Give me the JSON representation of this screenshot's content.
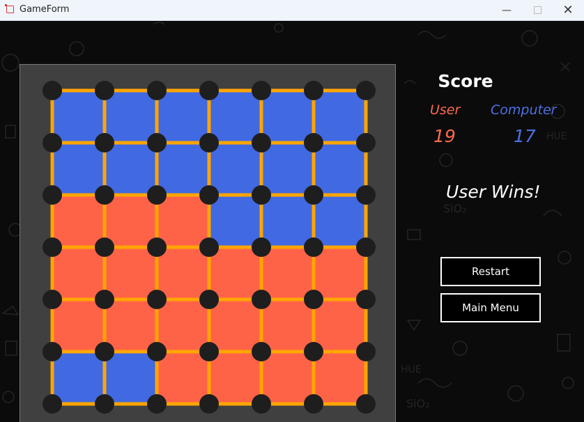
{
  "window": {
    "title": "GameForm",
    "minimize_glyph": "—",
    "close_glyph": "✕"
  },
  "colors": {
    "user": "#ff6347",
    "computer": "#4169e1",
    "line": "#ffa500",
    "dot": "#1e1e1e",
    "board_bg": "#404040"
  },
  "board": {
    "rows": 6,
    "cols": 6,
    "cells": [
      [
        "C",
        "C",
        "C",
        "C",
        "C",
        "C"
      ],
      [
        "C",
        "C",
        "C",
        "C",
        "C",
        "C"
      ],
      [
        "U",
        "U",
        "U",
        "C",
        "C",
        "C"
      ],
      [
        "U",
        "U",
        "U",
        "U",
        "U",
        "U"
      ],
      [
        "U",
        "U",
        "U",
        "U",
        "U",
        "U"
      ],
      [
        "C",
        "C",
        "U",
        "U",
        "U",
        "U"
      ]
    ]
  },
  "score": {
    "title": "Score",
    "user_label": "User",
    "computer_label": "Computer",
    "user_value": "19",
    "computer_value": "17"
  },
  "result_text": "User Wins!",
  "buttons": {
    "restart": "Restart",
    "main_menu": "Main Menu"
  }
}
